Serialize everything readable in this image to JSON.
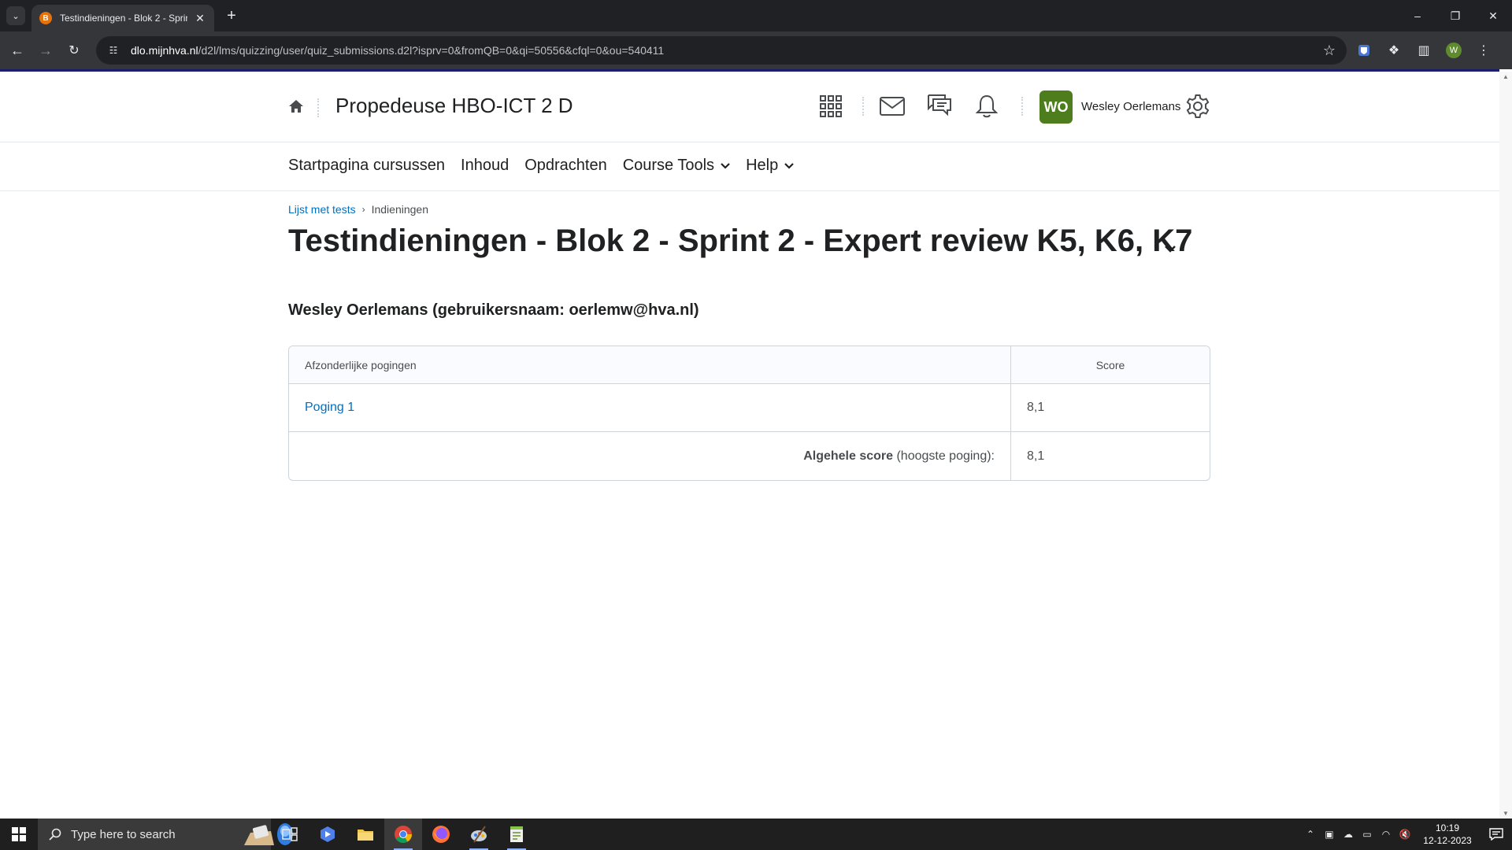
{
  "browser": {
    "tab_title": "Testindieningen - Blok 2 - Sprint 2 - Expert review K5, K6, K7",
    "favicon_letter": "B",
    "url_host": "dlo.mijnhva.nl",
    "url_path": "/d2l/lms/quizzing/user/quiz_submissions.d2l?isprv=0&fromQB=0&qi=50556&cfql=0&ou=540411",
    "profile_initial": "W"
  },
  "header": {
    "course_title": "Propedeuse HBO-ICT 2 D",
    "avatar_initials": "WO",
    "user_name": "Wesley Oerlemans"
  },
  "nav": {
    "items": [
      {
        "label": "Startpagina cursussen"
      },
      {
        "label": "Inhoud"
      },
      {
        "label": "Opdrachten"
      },
      {
        "label": "Course Tools"
      },
      {
        "label": "Help"
      }
    ]
  },
  "breadcrumb": {
    "parent": "Lijst met tests",
    "current": "Indieningen"
  },
  "page": {
    "title": "Testindieningen - Blok 2 - Sprint 2 - Expert review K5, K6, K7",
    "student": "Wesley Oerlemans (gebruikersnaam: oerlemw@hva.nl)"
  },
  "table": {
    "col_attempts": "Afzonderlijke pogingen",
    "col_score": "Score",
    "rows": [
      {
        "attempt": "Poging 1",
        "score": "8,1"
      }
    ],
    "overall_label": "Algehele score",
    "overall_note": "(hoogste poging):",
    "overall_score": "8,1"
  },
  "taskbar": {
    "search_placeholder": "Type here to search",
    "time": "10:19",
    "date": "12-12-2023"
  }
}
